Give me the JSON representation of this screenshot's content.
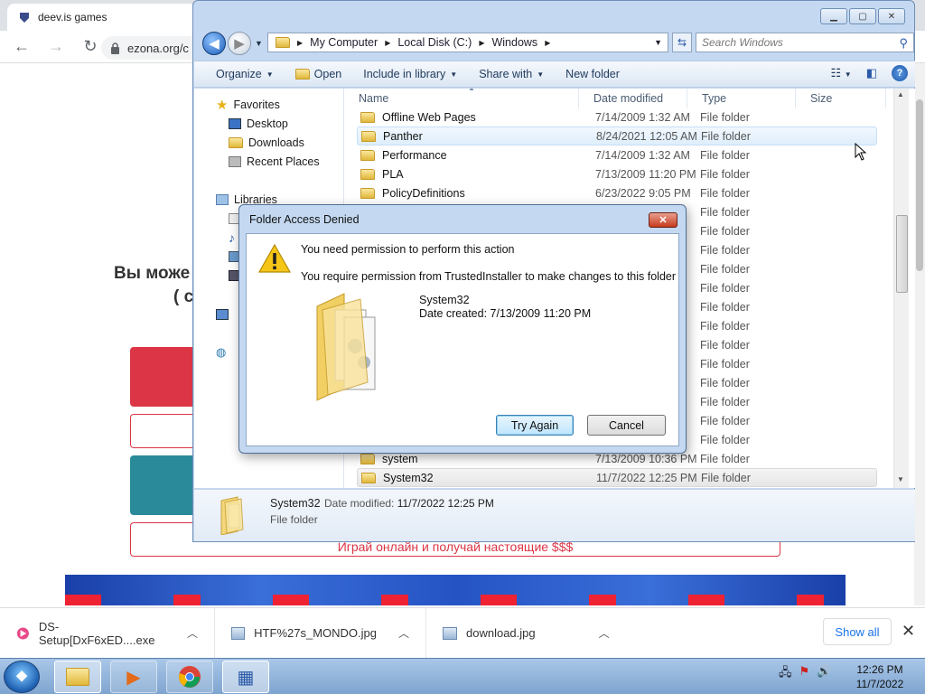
{
  "browser": {
    "tab_title": "deev.is games",
    "url": "ezona.org/c",
    "heading_line1": "Вы може",
    "heading_line2": "( с",
    "promo_text": "Играй онлайн и получай настоящие $$$",
    "colors": {
      "red": "#dc3545",
      "teal": "#2a8a9a",
      "banner": "#2553c4"
    }
  },
  "downloads": {
    "items": [
      {
        "name": "DS-Setup[DxF6xED....exe",
        "icon": "app-icon"
      },
      {
        "name": "HTF%27s_MONDO.jpg",
        "icon": "image-file-icon"
      },
      {
        "name": "download.jpg",
        "icon": "image-file-icon"
      }
    ],
    "show_all": "Show all",
    "close": "✕"
  },
  "explorer": {
    "breadcrumb": [
      "My Computer",
      "Local Disk (C:)",
      "Windows"
    ],
    "search_placeholder": "Search Windows",
    "commands": {
      "organize": "Organize",
      "open": "Open",
      "include_in_library": "Include in library",
      "share_with": "Share with",
      "new_folder": "New folder"
    },
    "nav": {
      "favorites": "Favorites",
      "desktop": "Desktop",
      "downloads": "Downloads",
      "recent_places": "Recent Places",
      "libraries": "Libraries"
    },
    "columns": {
      "name": "Name",
      "date": "Date modified",
      "type": "Type",
      "size": "Size"
    },
    "rows": [
      {
        "name": "Offline Web Pages",
        "date": "7/14/2009 1:32 AM",
        "type": "File folder"
      },
      {
        "name": "Panther",
        "date": "8/24/2021 12:05 AM",
        "type": "File folder"
      },
      {
        "name": "Performance",
        "date": "7/14/2009 1:32 AM",
        "type": "File folder"
      },
      {
        "name": "PLA",
        "date": "7/13/2009 11:20 PM",
        "type": "File folder"
      },
      {
        "name": "PolicyDefinitions",
        "date": "6/23/2022 9:05 PM",
        "type": "File folder"
      }
    ],
    "hidden_rows_type": "File folder",
    "bottom_rows": [
      {
        "name": "system",
        "date": "7/13/2009 10:36 PM",
        "type": "File folder"
      },
      {
        "name": "System32",
        "date": "11/7/2022 12:25 PM",
        "type": "File folder"
      }
    ],
    "details": {
      "name": "System32",
      "modified_label": "Date modified:",
      "modified_value": "11/7/2022 12:25 PM",
      "type": "File folder"
    }
  },
  "dialog": {
    "title": "Folder Access Denied",
    "message1": "You need permission to perform this action",
    "message2": "You require permission from TrustedInstaller to make changes to this folder",
    "folder_name": "System32",
    "date_created": "Date created: 7/13/2009 11:20 PM",
    "try_again": "Try Again",
    "cancel": "Cancel"
  },
  "taskbar": {
    "time": "12:26 PM",
    "date": "11/7/2022"
  }
}
